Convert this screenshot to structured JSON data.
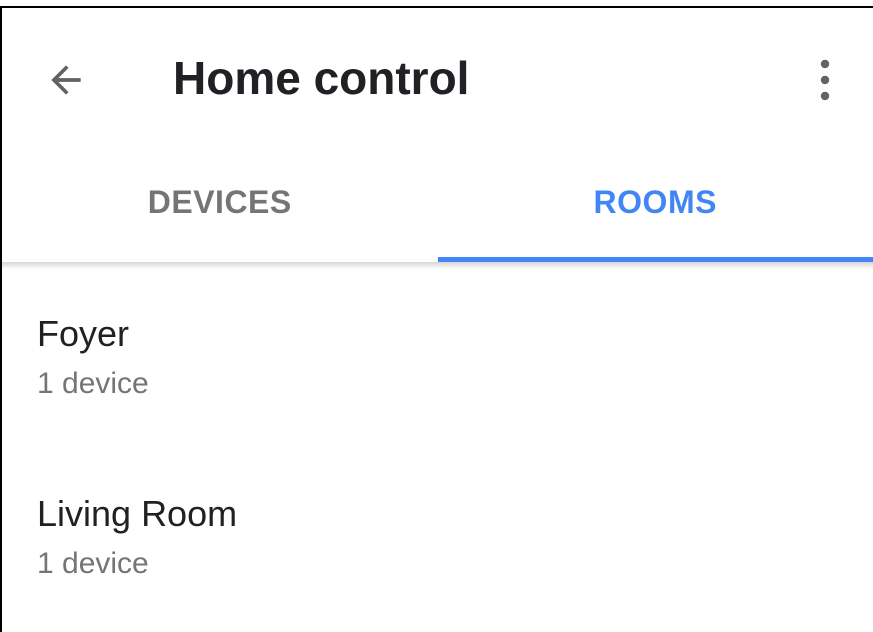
{
  "app_bar": {
    "back_icon": "arrow-back-icon",
    "title": "Home control",
    "menu_icon": "more-vert-icon"
  },
  "tabs": [
    {
      "label": "DEVICES",
      "active": false
    },
    {
      "label": "ROOMS",
      "active": true
    }
  ],
  "rooms": [
    {
      "name": "Foyer",
      "count": "1 device"
    },
    {
      "name": "Living Room",
      "count": "1 device"
    }
  ],
  "colors": {
    "accent": "#4285f4",
    "primary_text": "#202124",
    "secondary_text": "#757575"
  }
}
